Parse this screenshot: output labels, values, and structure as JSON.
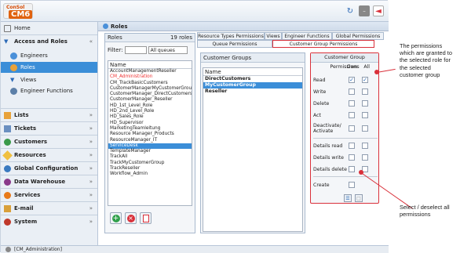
{
  "app": {
    "logo_top": "ConSol",
    "logo_bottom": "CM6"
  },
  "sidebar": {
    "home": "Home",
    "access_roles": "Access and Roles",
    "engineers": "Engineers",
    "roles": "Roles",
    "views": "Views",
    "engineer_functions": "Engineer Functions",
    "lists": "Lists",
    "tickets": "Tickets",
    "customers": "Customers",
    "resources": "Resources",
    "global_configuration": "Global Configuration",
    "data_warehouse": "Data Warehouse",
    "services": "Services",
    "email": "E-mail",
    "system": "System"
  },
  "content": {
    "title": "Roles",
    "roles_panel": {
      "title": "Roles",
      "count": "19 roles",
      "filter_label": "Filter:",
      "filter_select": "All queues",
      "list_header": "Name",
      "items": [
        "AccountManagementReseller",
        "CM_Administration",
        "CM_TrackBasicCustomers",
        "CustomerManagerMyCustomerGroup",
        "CustomerManager_DirectCustomers",
        "CustomerManager_Reseller",
        "HD_1st_Level_Role",
        "HD_2nd_Level_Role",
        "HD_Sales_Role",
        "HD_Supervisor",
        "MarketingTeamleitung",
        "Resource Manager_Products",
        "ResourceManager_IT",
        "ServiceDesk",
        "TemplateManager",
        "TrackAll",
        "TrackMyCustomerGroup",
        "TrackReseller",
        "Workflow_Admin"
      ]
    },
    "tabs": {
      "resource_types": "Resource Types Permissions",
      "views": "Views",
      "engineer_functions": "Engineer Functions",
      "global_permissions": "Global Permissions",
      "queue_permissions": "Queue Permissions",
      "customer_group_permissions": "Customer Group Permissions"
    },
    "customer_groups": {
      "title": "Customer Groups",
      "header": "Name",
      "items": [
        "DirectCustomers",
        "MyCustomerGroup",
        "Reseller"
      ]
    },
    "permissions": {
      "title": "Customer Group Permissions",
      "own": "Own",
      "all": "All",
      "read": "Read",
      "write": "Write",
      "delete": "Delete",
      "act": "Act",
      "deactivate1": "Deactivate/",
      "deactivate2": "Activate",
      "details_read": "Details read",
      "details_write": "Details write",
      "details_delete": "Details delete",
      "create": "Create"
    }
  },
  "statusbar": {
    "user": "[CM_Administration]"
  },
  "annotations": {
    "granted_1": "The permissions",
    "granted_2": "which are granted to",
    "granted_3": "the selected role for",
    "granted_4": "the selected",
    "granted_5": "customer group",
    "select_1": "Select / deselect all",
    "select_2": "permissions"
  }
}
